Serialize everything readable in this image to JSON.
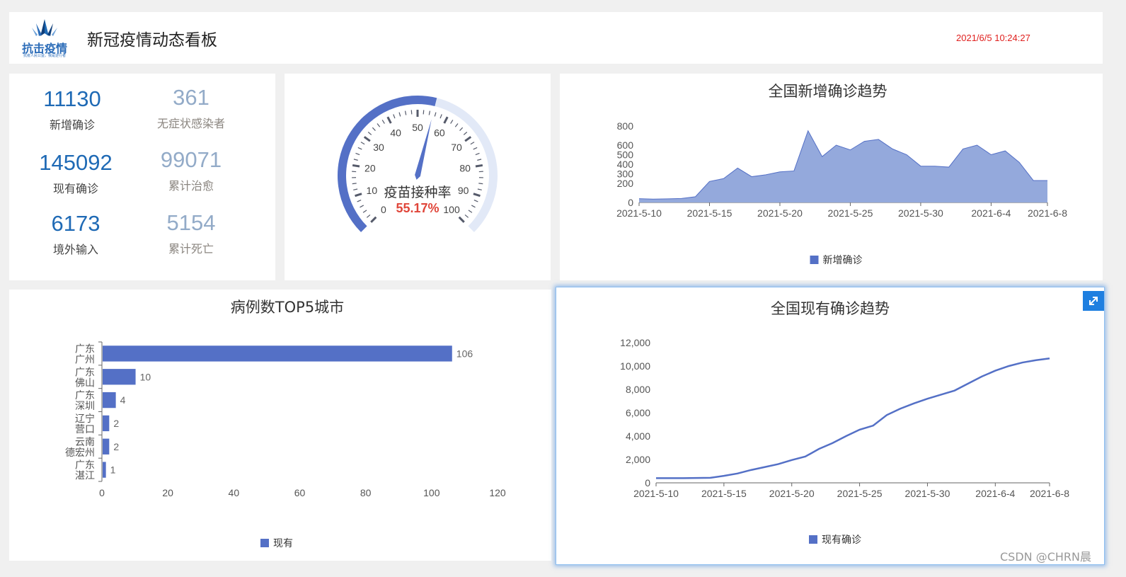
{
  "header": {
    "logo_text": "抗击疫情",
    "logo_sub": "抗疫人民公益，我是逆行者",
    "title": "新冠疫情动态看板",
    "time": "2021/6/5 10:24:27"
  },
  "stats": [
    {
      "value": "11130",
      "label": "新增确诊",
      "style": "primary"
    },
    {
      "value": "361",
      "label": "无症状感染者",
      "style": "muted"
    },
    {
      "value": "145092",
      "label": "现有确诊",
      "style": "primary"
    },
    {
      "value": "99071",
      "label": "累计治愈",
      "style": "muted"
    },
    {
      "value": "6173",
      "label": "境外输入",
      "style": "primary"
    },
    {
      "value": "5154",
      "label": "累计死亡",
      "style": "muted"
    }
  ],
  "gauge": {
    "title": "疫苗接种率",
    "value": 55.17,
    "value_text": "55.17%",
    "min": 0,
    "max": 100,
    "tick_labels": [
      "0",
      "10",
      "20",
      "30",
      "40",
      "50",
      "60",
      "70",
      "80",
      "90",
      "100"
    ],
    "colors": {
      "progress": "#5470c6",
      "track": "#e2e9f7",
      "value": "#e0463a",
      "pointer": "#5470c6"
    }
  },
  "chart_data": [
    {
      "id": "new-cases",
      "type": "area",
      "title": "全国新增确诊趋势",
      "x": [
        "2021-5-10",
        "2021-5-11",
        "2021-5-12",
        "2021-5-13",
        "2021-5-14",
        "2021-5-15",
        "2021-5-16",
        "2021-5-17",
        "2021-5-18",
        "2021-5-19",
        "2021-5-20",
        "2021-5-21",
        "2021-5-22",
        "2021-5-23",
        "2021-5-24",
        "2021-5-25",
        "2021-5-26",
        "2021-5-27",
        "2021-5-28",
        "2021-5-29",
        "2021-5-30",
        "2021-5-31",
        "2021-6-1",
        "2021-6-2",
        "2021-6-3",
        "2021-6-4",
        "2021-6-5",
        "2021-6-6",
        "2021-6-7",
        "2021-6-8"
      ],
      "x_ticks": [
        "2021-5-10",
        "2021-5-15",
        "2021-5-20",
        "2021-5-25",
        "2021-5-30",
        "2021-6-4",
        "2021-6-8"
      ],
      "series": [
        {
          "name": "新增确诊",
          "values": [
            40,
            35,
            38,
            42,
            60,
            220,
            250,
            360,
            270,
            290,
            320,
            330,
            750,
            480,
            600,
            550,
            640,
            660,
            560,
            500,
            380,
            380,
            370,
            560,
            600,
            500,
            540,
            420,
            230,
            230
          ]
        }
      ],
      "y_ticks": [
        "0",
        "200",
        "300",
        "400",
        "500",
        "600",
        "800"
      ],
      "ylim": [
        0,
        800
      ],
      "color": "#5470c6",
      "area_color": "#94a9dc",
      "legend": "bottom-center"
    },
    {
      "id": "top5",
      "type": "bar",
      "title": "病例数TOP5城市",
      "categories": [
        [
          "广东",
          "广州"
        ],
        [
          "广东",
          "佛山"
        ],
        [
          "广东",
          "深圳"
        ],
        [
          "辽宁",
          "营口"
        ],
        [
          "云南",
          "德宏州"
        ],
        [
          "广东",
          "湛江"
        ]
      ],
      "series": [
        {
          "name": "现有",
          "values": [
            106,
            10,
            4,
            2,
            2,
            1
          ]
        }
      ],
      "x_ticks": [
        "0",
        "20",
        "40",
        "60",
        "80",
        "100",
        "120"
      ],
      "xlim": [
        0,
        120
      ],
      "color": "#5470c6",
      "legend": "bottom-center"
    },
    {
      "id": "existing-cases",
      "type": "line",
      "title": "全国现有确诊趋势",
      "x": [
        "2021-5-10",
        "2021-5-11",
        "2021-5-12",
        "2021-5-13",
        "2021-5-14",
        "2021-5-15",
        "2021-5-16",
        "2021-5-17",
        "2021-5-18",
        "2021-5-19",
        "2021-5-20",
        "2021-5-21",
        "2021-5-22",
        "2021-5-23",
        "2021-5-24",
        "2021-5-25",
        "2021-5-26",
        "2021-5-27",
        "2021-5-28",
        "2021-5-29",
        "2021-5-30",
        "2021-5-31",
        "2021-6-1",
        "2021-6-2",
        "2021-6-3",
        "2021-6-4",
        "2021-6-5",
        "2021-6-6",
        "2021-6-7",
        "2021-6-8"
      ],
      "x_ticks": [
        "2021-5-10",
        "2021-5-15",
        "2021-5-20",
        "2021-5-25",
        "2021-5-30",
        "2021-6-4",
        "2021-6-8"
      ],
      "series": [
        {
          "name": "现有确诊",
          "values": [
            400,
            400,
            400,
            420,
            430,
            600,
            800,
            1100,
            1350,
            1600,
            1950,
            2250,
            2900,
            3400,
            4000,
            4550,
            4900,
            5800,
            6350,
            6800,
            7200,
            7550,
            7900,
            8500,
            9100,
            9600,
            10000,
            10300,
            10500,
            10650
          ]
        }
      ],
      "y_ticks": [
        "0",
        "2,000",
        "4,000",
        "6,000",
        "8,000",
        "10,000",
        "12,000"
      ],
      "ylim": [
        0,
        12000
      ],
      "color": "#5470c6",
      "legend": "bottom-center"
    }
  ],
  "watermark": "CSDN @CHRN晨"
}
